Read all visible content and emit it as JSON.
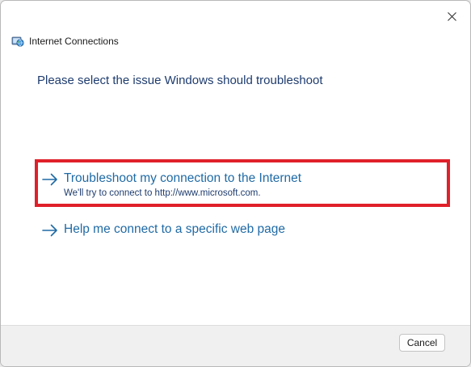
{
  "window": {
    "title": "Internet Connections",
    "close_icon": "close-icon",
    "app_icon": "network-globe-icon"
  },
  "main": {
    "heading": "Please select the issue Windows should troubleshoot",
    "options": [
      {
        "title": "Troubleshoot my connection to the Internet",
        "subtitle": "We'll try to connect to http://www.microsoft.com.",
        "icon": "arrow-right-icon",
        "highlighted": true
      },
      {
        "title": "Help me connect to a specific web page",
        "subtitle": "",
        "icon": "arrow-right-icon",
        "highlighted": false
      }
    ]
  },
  "footer": {
    "cancel_label": "Cancel"
  },
  "colors": {
    "link": "#1f6aa5",
    "heading": "#1e3c6e",
    "highlight": "#e0202a"
  }
}
